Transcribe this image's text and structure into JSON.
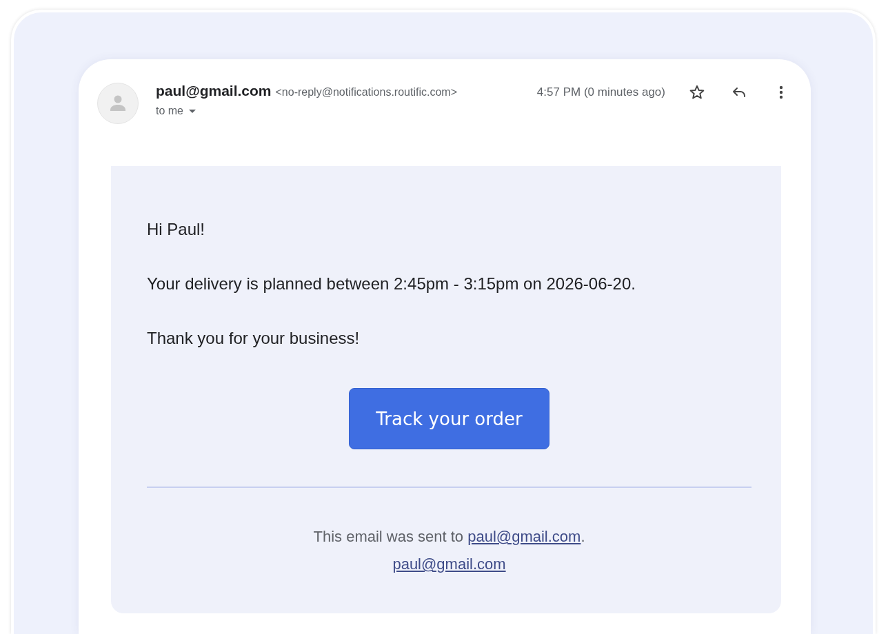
{
  "email": {
    "sender_name": "paul@gmail.com",
    "sender_address": "<no-reply@notifications.routific.com>",
    "recipient": "to me",
    "time": "4:57 PM (0 minutes ago)",
    "starred": false
  },
  "message": {
    "paragraphs": [
      "Hi Paul!",
      "Your delivery is planned between 2:45pm - 3:15pm on 2026-06-20.",
      "Thank you for your business!"
    ],
    "button": "Track your order",
    "footer": {
      "text": "This email was sent to ",
      "link": "paul@gmail.com",
      "after": ".",
      "second_link": "paul@gmail.com"
    }
  }
}
